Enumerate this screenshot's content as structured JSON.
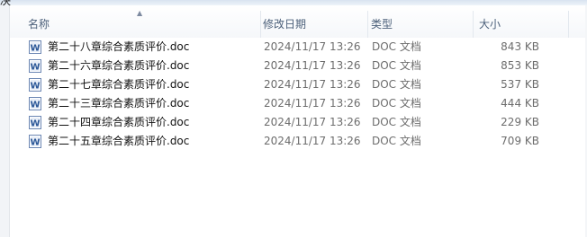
{
  "window": {
    "title_fragment": "决"
  },
  "columns": {
    "name": "名称",
    "date": "修改日期",
    "type": "类型",
    "size": "大小"
  },
  "sort_indicator": "▲",
  "files": [
    {
      "name": "第二十八章综合素质评价.doc",
      "date": "2024/11/17 13:26",
      "type": "DOC 文档",
      "size": "843 KB",
      "icon": "word-doc-icon"
    },
    {
      "name": "第二十六章综合素质评价.doc",
      "date": "2024/11/17 13:26",
      "type": "DOC 文档",
      "size": "853 KB",
      "icon": "word-doc-icon"
    },
    {
      "name": "第二十七章综合素质评价.doc",
      "date": "2024/11/17 13:26",
      "type": "DOC 文档",
      "size": "537 KB",
      "icon": "word-doc-icon"
    },
    {
      "name": "第二十三章综合素质评价.doc",
      "date": "2024/11/17 13:26",
      "type": "DOC 文档",
      "size": "444 KB",
      "icon": "word-doc-icon"
    },
    {
      "name": "第二十四章综合素质评价.doc",
      "date": "2024/11/17 13:26",
      "type": "DOC 文档",
      "size": "229 KB",
      "icon": "word-doc-icon"
    },
    {
      "name": "第二十五章综合素质评价.doc",
      "date": "2024/11/17 13:26",
      "type": "DOC 文档",
      "size": "709 KB",
      "icon": "word-doc-icon"
    }
  ],
  "colors": {
    "header_text": "#4c607a",
    "meta_text": "#6d6d6d",
    "icon_blue": "#2b5797"
  }
}
